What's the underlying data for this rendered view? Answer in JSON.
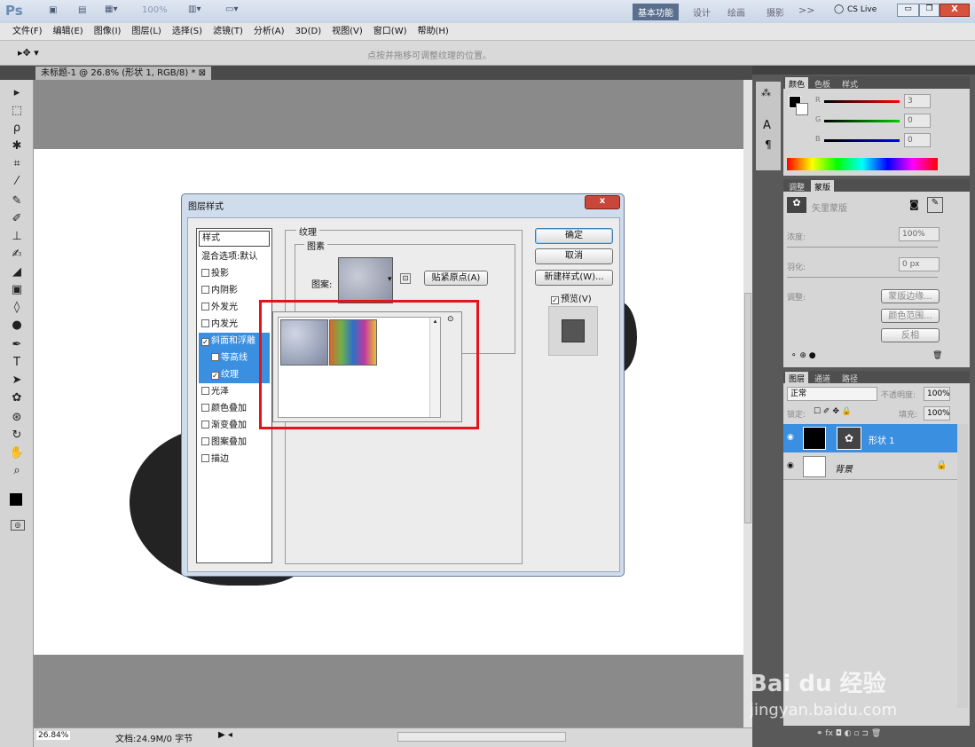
{
  "app": {
    "logo": "Ps",
    "workspace_tabs": [
      "基本功能",
      "设计",
      "绘画",
      "摄影"
    ],
    "more": ">>",
    "cslive": "CS Live",
    "zoom": "100%"
  },
  "menu": [
    "文件(F)",
    "编辑(E)",
    "图像(I)",
    "图层(L)",
    "选择(S)",
    "滤镜(T)",
    "分析(A)",
    "3D(D)",
    "视图(V)",
    "窗口(W)",
    "帮助(H)"
  ],
  "options": {
    "hint": "点按并拖移可调整纹理的位置。"
  },
  "document": {
    "tab": "未标题-1 @ 26.8% (形状 1, RGB/8) *"
  },
  "status": {
    "zoom": "26.84%",
    "doc": "文档:24.9M/0 字节"
  },
  "dialog": {
    "title": "图层样式",
    "left_header": "样式",
    "blend": "混合选项:默认",
    "items": [
      {
        "label": "投影",
        "checked": false
      },
      {
        "label": "内阴影",
        "checked": false
      },
      {
        "label": "外发光",
        "checked": false
      },
      {
        "label": "内发光",
        "checked": false
      },
      {
        "label": "斜面和浮雕",
        "checked": true
      },
      {
        "label": "等高线",
        "checked": false
      },
      {
        "label": "纹理",
        "checked": true
      },
      {
        "label": "光泽",
        "checked": false
      },
      {
        "label": "颜色叠加",
        "checked": false
      },
      {
        "label": "渐变叠加",
        "checked": false
      },
      {
        "label": "图案叠加",
        "checked": false
      },
      {
        "label": "描边",
        "checked": false
      }
    ],
    "group_title": "纹理",
    "sub_group": "图素",
    "pattern_label": "图案:",
    "snap_button": "贴紧原点(A)",
    "ok": "确定",
    "cancel": "取消",
    "new_style": "新建样式(W)...",
    "preview": "预览(V)"
  },
  "panels": {
    "color_tabs": [
      "颜色",
      "色板",
      "样式"
    ],
    "rgb": [
      {
        "label": "R",
        "value": "3"
      },
      {
        "label": "G",
        "value": "0"
      },
      {
        "label": "B",
        "value": "0"
      }
    ],
    "adj_tabs": [
      "调整",
      "蒙版"
    ],
    "mask_title": "矢里蒙版",
    "density_label": "浓度:",
    "density": "100%",
    "feather_label": "羽化:",
    "feather": "0 px",
    "refine_label": "调整:",
    "mask_edge": "蒙版边缘...",
    "color_range": "颜色范围...",
    "invert": "反相",
    "layer_tabs": [
      "图层",
      "通道",
      "路径"
    ],
    "blend_mode": "正常",
    "opacity_label": "不透明度:",
    "opacity": "100%",
    "lock_label": "锁定:",
    "fill_label": "填充:",
    "fill": "100%",
    "layers": [
      {
        "name": "形状 1"
      },
      {
        "name": "背景"
      }
    ]
  },
  "watermark": {
    "brand": "Bai du 经验",
    "url": "jingyan.baidu.com"
  }
}
